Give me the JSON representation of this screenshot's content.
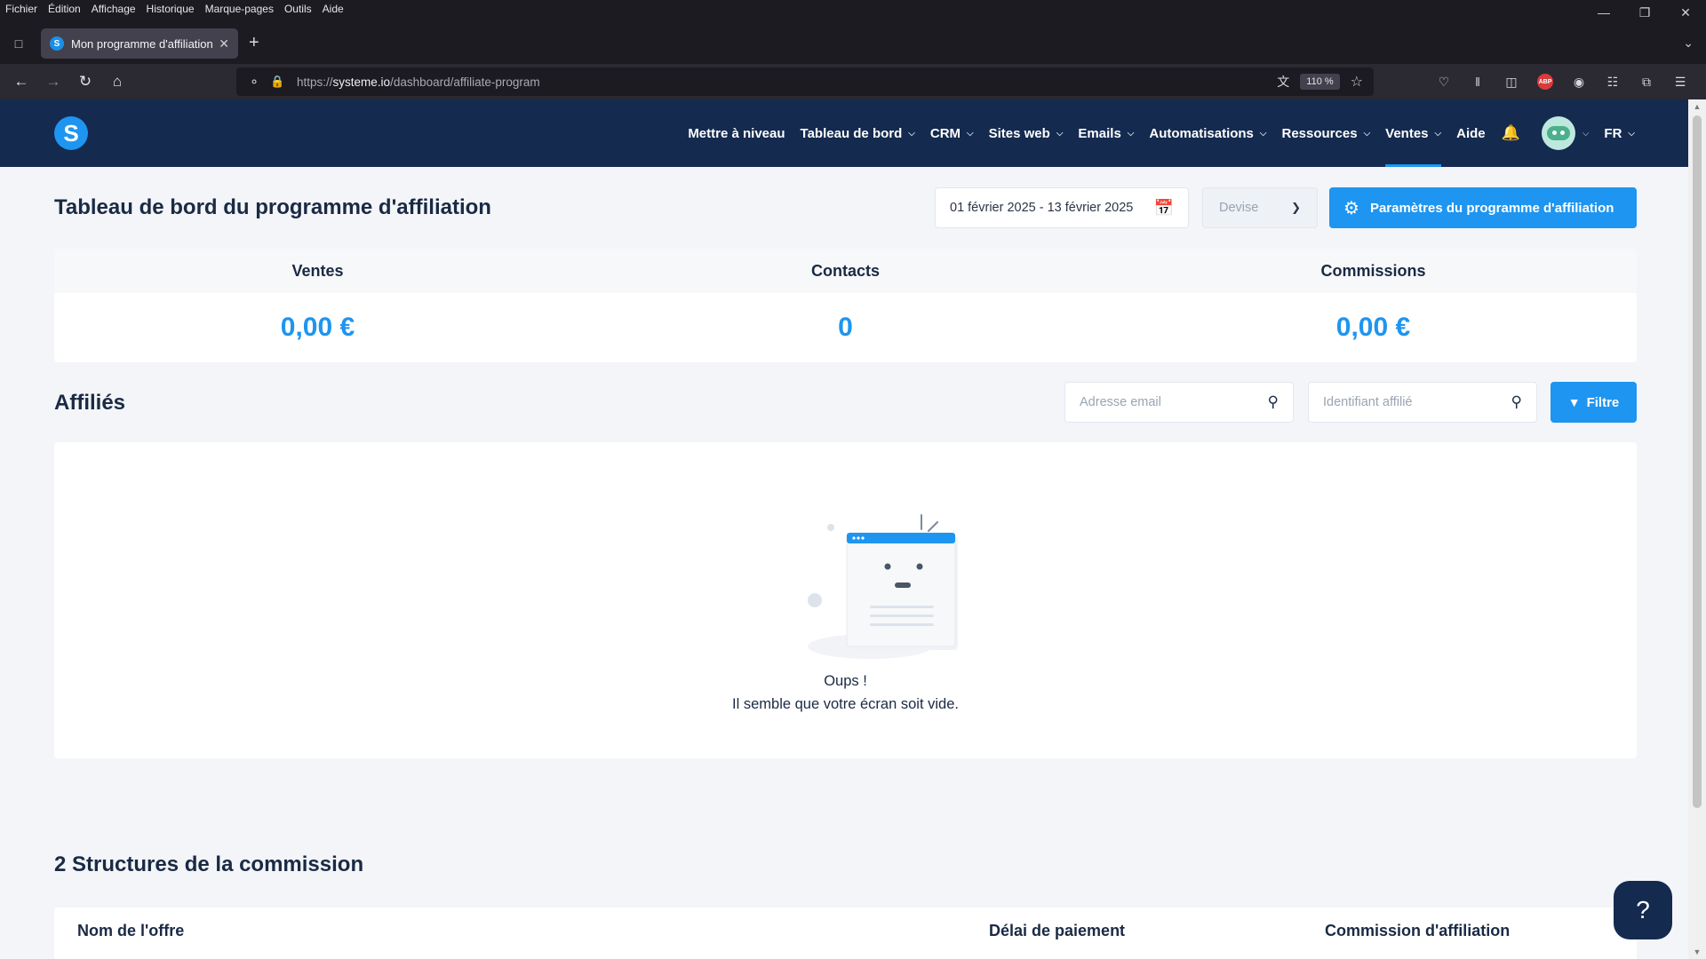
{
  "browser": {
    "menu": [
      "Fichier",
      "Édition",
      "Affichage",
      "Historique",
      "Marque-pages",
      "Outils",
      "Aide"
    ],
    "tab_title": "Mon programme d'affiliation",
    "favicon_letter": "S",
    "url_prefix": "https://",
    "url_domain": "systeme.io",
    "url_path": "/dashboard/affiliate-program",
    "zoom": "110 %"
  },
  "header": {
    "logo_letter": "S",
    "nav": [
      {
        "label": "Mettre à niveau",
        "dropdown": false
      },
      {
        "label": "Tableau de bord",
        "dropdown": true
      },
      {
        "label": "CRM",
        "dropdown": true
      },
      {
        "label": "Sites web",
        "dropdown": true
      },
      {
        "label": "Emails",
        "dropdown": true
      },
      {
        "label": "Automatisations",
        "dropdown": true
      },
      {
        "label": "Ressources",
        "dropdown": true
      },
      {
        "label": "Ventes",
        "dropdown": true,
        "active": true
      },
      {
        "label": "Aide",
        "dropdown": false
      }
    ],
    "language": "FR"
  },
  "page": {
    "title": "Tableau de bord du programme d'affiliation",
    "date_range": "01 février 2025 - 13 février 2025",
    "currency_placeholder": "Devise",
    "settings_button": "Paramètres du programme d'affiliation"
  },
  "stats": [
    {
      "label": "Ventes",
      "value": "0,00 €"
    },
    {
      "label": "Contacts",
      "value": "0"
    },
    {
      "label": "Commissions",
      "value": "0,00 €"
    }
  ],
  "affiliates": {
    "title": "Affiliés",
    "email_placeholder": "Adresse email",
    "id_placeholder": "Identifiant affilié",
    "filter_button": "Filtre",
    "empty_title": "Oups !",
    "empty_subtitle": "Il semble que votre écran soit vide."
  },
  "commissions": {
    "title": "2 Structures de la commission",
    "columns": [
      "Nom de l'offre",
      "Délai de paiement",
      "Commission d'affiliation"
    ]
  },
  "colors": {
    "header_bg": "#142a4f",
    "accent": "#1e95f0",
    "page_bg": "#f3f5f8"
  },
  "help_button": "?"
}
